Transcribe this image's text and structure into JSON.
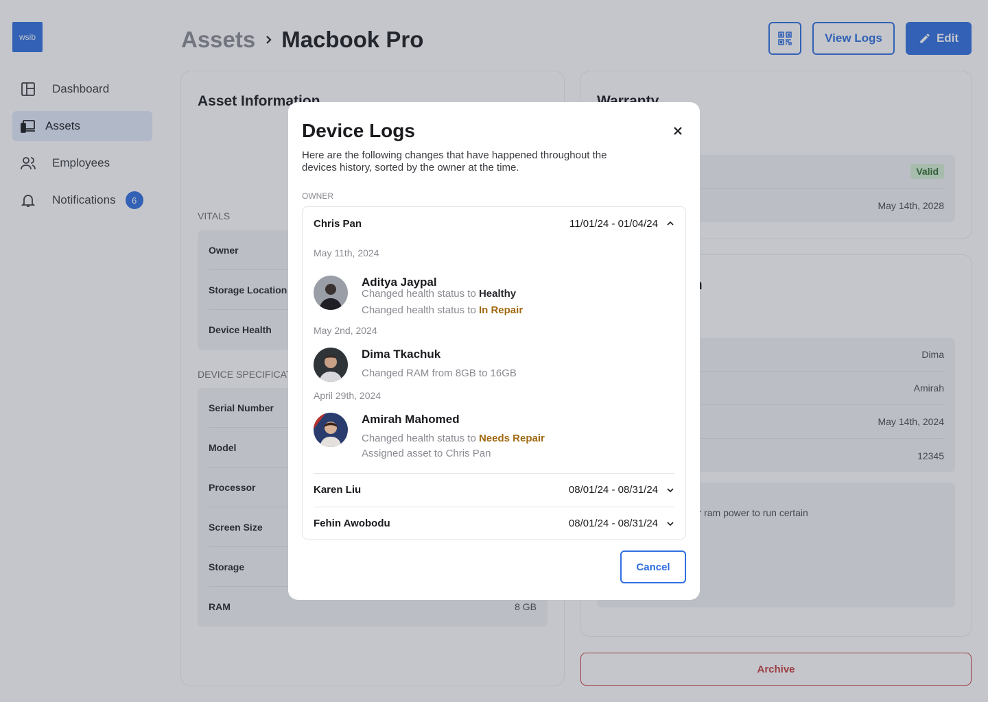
{
  "app": {
    "logo_text": "wsib"
  },
  "sidebar": {
    "items": [
      {
        "label": "Dashboard",
        "icon": "layout-icon"
      },
      {
        "label": "Assets",
        "icon": "devices-icon",
        "active": true
      },
      {
        "label": "Employees",
        "icon": "users-icon"
      },
      {
        "label": "Notifications",
        "icon": "bell-icon",
        "badge": "6"
      }
    ]
  },
  "header": {
    "breadcrumb_root": "Assets",
    "breadcrumb_current": "Macbook Pro",
    "view_logs_label": "View Logs",
    "edit_label": "Edit"
  },
  "asset_info": {
    "title": "Asset Information",
    "vitals_label": "VITALS",
    "vitals": [
      {
        "key": "Owner"
      },
      {
        "key": "Storage Location"
      },
      {
        "key": "Device Health"
      }
    ],
    "specs_label": "DEVICE SPECIFICATI",
    "specs": [
      {
        "key": "Serial Number",
        "value": ""
      },
      {
        "key": "Model",
        "value": ""
      },
      {
        "key": "Processor",
        "value": ""
      },
      {
        "key": "Screen Size",
        "value": ""
      },
      {
        "key": "Storage",
        "value": ""
      },
      {
        "key": "RAM",
        "value": "8 GB"
      }
    ]
  },
  "warranty": {
    "title": "Warranty",
    "status": "Valid",
    "expiry": "May 14th, 2028"
  },
  "history": {
    "title_fragment": "on",
    "values": [
      "Dima",
      "Amirah",
      "May 14th, 2024",
      "12345"
    ],
    "note_title_fragment": "e",
    "note_text": "team needed a higher ram power to run certain"
  },
  "archive_label": "Archive",
  "colors": {
    "primary": "#2f6fe0",
    "warning": "#a06a12",
    "danger": "#c43b3b",
    "valid_bg": "#d6f1d4"
  },
  "modal": {
    "title": "Device Logs",
    "description": "Here are the following changes that have happened throughout the devices history, sorted by the owner at the time.",
    "owner_label": "OWNER",
    "owners": [
      {
        "name": "Chris Pan",
        "range": "11/01/24 - 01/04/24",
        "expanded": true,
        "groups": [
          {
            "date": "May 11th, 2024",
            "user": "Aditya Jaypal",
            "lines": [
              {
                "prefix": "Changed health status to ",
                "value": "Healthy"
              },
              {
                "prefix": "Changed health status to ",
                "value": "In Repair"
              }
            ]
          },
          {
            "date": "May 2nd, 2024",
            "user": "Dima Tkachuk",
            "lines": [
              {
                "prefix": "Changed RAM from 8GB to 16GB",
                "value": ""
              }
            ]
          },
          {
            "date": "April 29th, 2024",
            "user": "Amirah Mahomed",
            "lines": [
              {
                "prefix": "Changed health status to ",
                "value": "Needs Repair"
              },
              {
                "prefix": "Assigned asset to Chris Pan",
                "value": ""
              }
            ]
          }
        ]
      },
      {
        "name": "Karen Liu",
        "range": "08/01/24 - 08/31/24",
        "expanded": false
      },
      {
        "name": "Fehin Awobodu",
        "range": "08/01/24 - 08/31/24",
        "expanded": false
      }
    ],
    "cancel_label": "Cancel"
  }
}
